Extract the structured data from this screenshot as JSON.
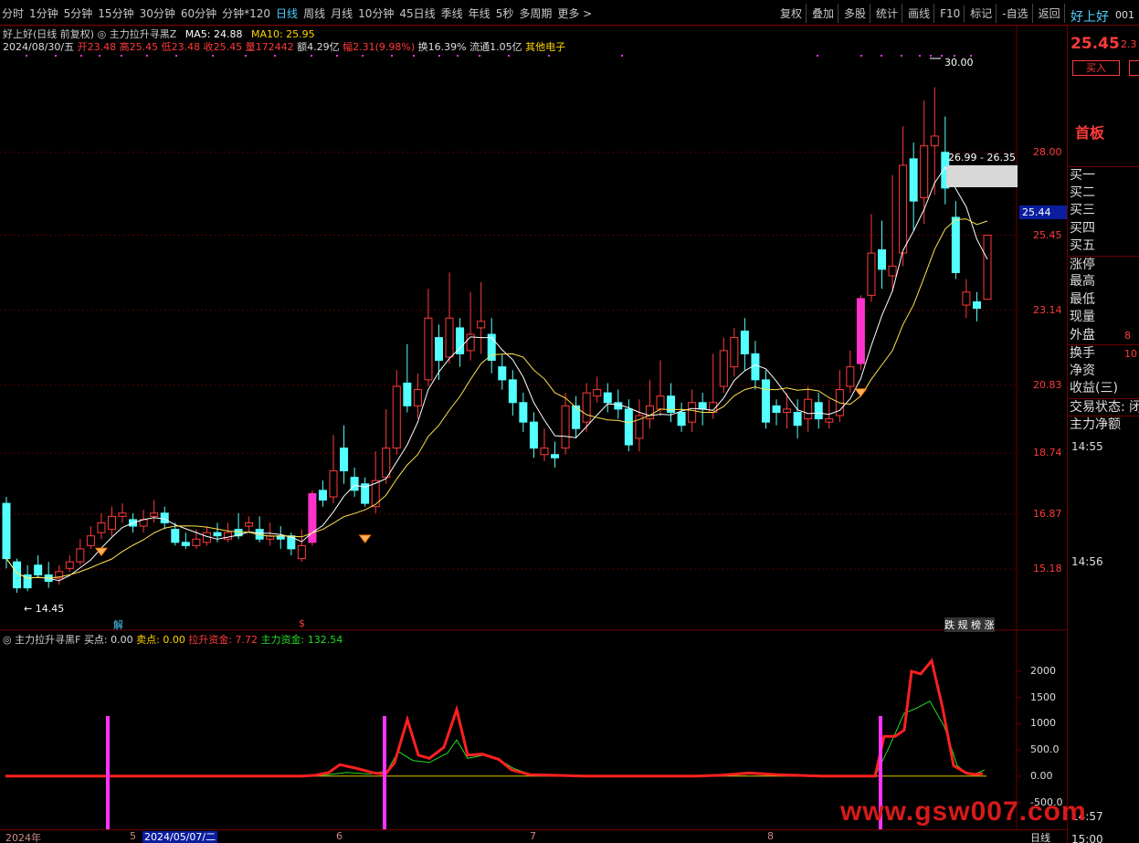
{
  "toolbar": {
    "tabs": [
      "分时",
      "1分钟",
      "5分钟",
      "15分钟",
      "30分钟",
      "60分钟",
      "分钟*120",
      "日线",
      "周线",
      "月线",
      "10分钟",
      "45日线",
      "季线",
      "年线",
      "5秒",
      "多周期",
      "更多 >"
    ],
    "active_tab": "日线",
    "buttons": [
      "复权",
      "叠加",
      "多股",
      "统计",
      "画线",
      "F10",
      "标记",
      "-自选",
      "返回"
    ]
  },
  "stock": {
    "name": "好上好",
    "code_partial": "001",
    "last_price": "25.45",
    "change_partial": "2.3"
  },
  "info": {
    "title": "好上好(日线 前复权)",
    "indicator": "主力拉升寻黑Z",
    "ma5_label": "MA5: 24.88",
    "ma10_label": "MA10: 25.95",
    "date": "2024/08/30/五",
    "open": "开23.48",
    "high": "高25.45",
    "low": "低23.48",
    "close": "收25.45",
    "volume": "量172442",
    "amount": "额4.29亿",
    "amplitude": "幅2.31(9.98%)",
    "turnover": "换16.39%",
    "float": "流通1.05亿",
    "sector": "其他电子"
  },
  "price_axis": [
    "28.00",
    "25.45",
    "23.14",
    "20.83",
    "18.74",
    "16.87",
    "15.18"
  ],
  "current_price_tag": "25.44",
  "annotations": {
    "high_label": "30.00",
    "low_label": "← 14.45",
    "range_label": "26.99 - 26.35",
    "marker_jie": "解",
    "marker_dollar": "$",
    "marker_tags": "跌 规 榜 涨"
  },
  "sub_indicator": {
    "name": "主力拉升寻黑F",
    "buy": "买点: 0.00",
    "sell": "卖点: 0.00",
    "lift": "拉升资金: 7.72",
    "main": "主力资金: 132.54",
    "axis": [
      "2000",
      "1500",
      "1000",
      "500.0",
      "0.00",
      "-500.0"
    ]
  },
  "time_axis": {
    "labels": [
      "2024年",
      "5",
      "6",
      "7",
      "8"
    ],
    "cursor_date": "2024/05/07/二",
    "period_label": "日线"
  },
  "right_panel": {
    "buy_button": "买入",
    "board": "首板",
    "orders": [
      "买一",
      "买二",
      "买三",
      "买四",
      "买五"
    ],
    "stats": [
      "涨停",
      "最高",
      "最低",
      "现量",
      "外盘"
    ],
    "stat_values": [
      "",
      "",
      "",
      "",
      "8"
    ],
    "stats2": [
      "换手",
      "净资",
      "收益(三)"
    ],
    "stat2_values": [
      "10",
      "",
      ""
    ],
    "trade_status": "交易状态: 闭",
    "main_net": "主力净额",
    "times": [
      "14:55",
      "14:56",
      "14:57",
      "15:00"
    ]
  },
  "watermark": "www.gsw007.com",
  "chart_data": {
    "type": "candlestick",
    "title": "好上好(日线 前复权)",
    "ylim": [
      14.0,
      31.0
    ],
    "y_ticks": [
      28.0,
      25.45,
      23.14,
      20.83,
      18.74,
      16.87,
      15.18
    ],
    "candles": [
      [
        17.2,
        15.5,
        17.4,
        15.2
      ],
      [
        15.4,
        14.6,
        15.5,
        14.45
      ],
      [
        15.0,
        14.6,
        15.3,
        14.5
      ],
      [
        15.3,
        15.0,
        15.6,
        14.9
      ],
      [
        15.0,
        14.8,
        15.4,
        14.6
      ],
      [
        14.9,
        15.1,
        15.3,
        14.7
      ],
      [
        15.2,
        15.4,
        15.6,
        15.1
      ],
      [
        15.4,
        15.8,
        16.1,
        15.3
      ],
      [
        15.9,
        16.2,
        16.5,
        15.8
      ],
      [
        16.3,
        16.6,
        16.9,
        16.1
      ],
      [
        16.4,
        16.8,
        17.1,
        16.2
      ],
      [
        16.8,
        16.9,
        17.2,
        16.6
      ],
      [
        16.7,
        16.5,
        16.9,
        16.3
      ],
      [
        16.5,
        16.7,
        17.0,
        16.3
      ],
      [
        16.8,
        16.9,
        17.3,
        16.6
      ],
      [
        16.9,
        16.6,
        17.1,
        16.4
      ],
      [
        16.4,
        16.0,
        16.6,
        15.9
      ],
      [
        16.0,
        15.9,
        16.3,
        15.8
      ],
      [
        15.9,
        16.1,
        16.4,
        15.8
      ],
      [
        16.0,
        16.3,
        16.5,
        15.9
      ],
      [
        16.3,
        16.2,
        16.6,
        16.0
      ],
      [
        16.1,
        16.3,
        16.6,
        16.0
      ],
      [
        16.4,
        16.2,
        16.9,
        16.1
      ],
      [
        16.5,
        16.6,
        16.8,
        16.3
      ],
      [
        16.4,
        16.1,
        16.8,
        16.0
      ],
      [
        16.1,
        16.2,
        16.6,
        15.9
      ],
      [
        16.2,
        16.1,
        16.5,
        15.8
      ],
      [
        16.2,
        15.8,
        16.3,
        15.6
      ],
      [
        15.5,
        15.9,
        16.4,
        15.4
      ],
      [
        16.0,
        17.5,
        17.6,
        15.9
      ],
      [
        17.6,
        17.3,
        17.9,
        17.1
      ],
      [
        17.4,
        18.2,
        19.3,
        17.2
      ],
      [
        18.9,
        18.2,
        19.6,
        17.8
      ],
      [
        18.0,
        17.6,
        18.3,
        17.4
      ],
      [
        17.8,
        17.2,
        18.0,
        17.1
      ],
      [
        17.1,
        17.9,
        18.8,
        16.9
      ],
      [
        18.0,
        18.9,
        20.1,
        17.8
      ],
      [
        18.9,
        20.8,
        21.3,
        18.7
      ],
      [
        20.9,
        20.2,
        22.1,
        20.0
      ],
      [
        20.2,
        20.7,
        21.2,
        19.8
      ],
      [
        21.0,
        22.9,
        23.8,
        20.8
      ],
      [
        22.3,
        21.6,
        22.7,
        21.0
      ],
      [
        21.7,
        22.9,
        24.3,
        21.5
      ],
      [
        22.6,
        21.8,
        22.9,
        21.4
      ],
      [
        21.9,
        22.4,
        23.7,
        21.6
      ],
      [
        22.6,
        22.8,
        24.0,
        21.8
      ],
      [
        22.4,
        21.6,
        22.9,
        21.2
      ],
      [
        21.4,
        21.0,
        21.8,
        20.7
      ],
      [
        21.0,
        20.3,
        21.3,
        19.9
      ],
      [
        20.3,
        19.7,
        20.6,
        19.4
      ],
      [
        19.7,
        18.9,
        20.0,
        18.6
      ],
      [
        18.7,
        18.9,
        19.5,
        18.5
      ],
      [
        18.7,
        18.6,
        19.1,
        18.3
      ],
      [
        18.9,
        20.2,
        20.6,
        18.7
      ],
      [
        20.2,
        19.5,
        20.5,
        19.2
      ],
      [
        19.7,
        20.6,
        20.9,
        19.4
      ],
      [
        20.5,
        20.7,
        21.1,
        20.3
      ],
      [
        20.6,
        20.3,
        20.9,
        20.0
      ],
      [
        20.3,
        20.1,
        20.7,
        19.8
      ],
      [
        20.1,
        19.0,
        20.4,
        18.8
      ],
      [
        19.2,
        19.9,
        20.4,
        18.8
      ],
      [
        19.8,
        20.2,
        21.0,
        19.5
      ],
      [
        20.1,
        20.5,
        21.6,
        19.9
      ],
      [
        20.5,
        20.0,
        20.9,
        19.7
      ],
      [
        20.0,
        19.6,
        20.3,
        19.4
      ],
      [
        19.7,
        20.3,
        20.7,
        19.4
      ],
      [
        20.3,
        20.1,
        20.6,
        19.6
      ],
      [
        20.0,
        20.3,
        21.8,
        19.8
      ],
      [
        20.8,
        21.9,
        22.3,
        20.6
      ],
      [
        21.4,
        22.3,
        22.6,
        21.1
      ],
      [
        22.5,
        21.8,
        22.9,
        21.3
      ],
      [
        21.8,
        21.0,
        22.2,
        20.7
      ],
      [
        21.0,
        19.7,
        21.3,
        19.5
      ],
      [
        20.2,
        20.0,
        20.4,
        19.6
      ],
      [
        20.0,
        20.1,
        20.6,
        19.5
      ],
      [
        20.0,
        19.6,
        20.4,
        19.2
      ],
      [
        19.8,
        20.4,
        20.8,
        19.4
      ],
      [
        20.3,
        19.8,
        20.6,
        19.5
      ],
      [
        19.7,
        19.8,
        20.4,
        19.5
      ],
      [
        19.9,
        20.7,
        21.3,
        19.7
      ],
      [
        20.8,
        21.4,
        21.9,
        20.6
      ],
      [
        21.5,
        23.5,
        23.6,
        21.3
      ],
      [
        23.6,
        24.9,
        26.1,
        23.4
      ],
      [
        25.0,
        24.4,
        25.9,
        23.8
      ],
      [
        24.2,
        24.5,
        27.3,
        23.7
      ],
      [
        24.9,
        27.6,
        28.8,
        24.5
      ],
      [
        27.8,
        26.5,
        28.3,
        25.6
      ],
      [
        26.6,
        28.2,
        29.6,
        25.8
      ],
      [
        28.2,
        28.5,
        30.0,
        26.7
      ],
      [
        28.0,
        26.9,
        29.1,
        26.4
      ],
      [
        26.0,
        24.3,
        26.5,
        24.1
      ],
      [
        23.3,
        23.7,
        24.1,
        22.9
      ],
      [
        23.4,
        23.2,
        23.7,
        22.8
      ],
      [
        23.48,
        25.45,
        25.45,
        23.48
      ]
    ]
  }
}
